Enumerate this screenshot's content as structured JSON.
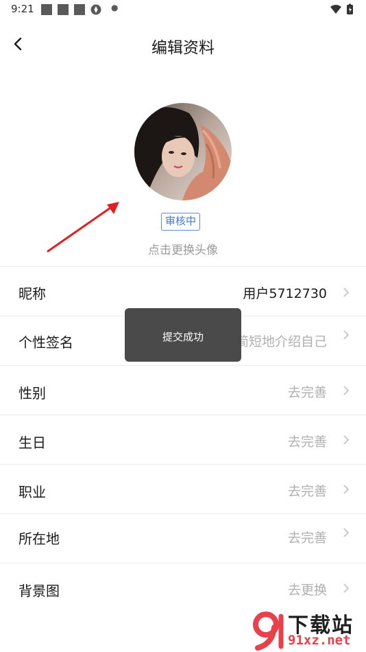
{
  "status_bar": {
    "time": "9:21"
  },
  "header": {
    "title": "编辑资料"
  },
  "avatar": {
    "badge": "审核中",
    "hint": "点击更换头像"
  },
  "rows": [
    {
      "label": "昵称",
      "value": "用户5712730"
    },
    {
      "label": "个性签名",
      "value": "简短地介绍自己"
    },
    {
      "label": "性别",
      "value": "去完善"
    },
    {
      "label": "生日",
      "value": "去完善"
    },
    {
      "label": "职业",
      "value": "去完善"
    },
    {
      "label": "所在地",
      "value": "去完善"
    },
    {
      "label": "背景图",
      "value": "去更换"
    }
  ],
  "toast": {
    "text": "提交成功"
  },
  "watermark": {
    "title": "下载站",
    "url": "91xz.net"
  },
  "colors": {
    "badge_blue": "#3f78e0",
    "annotation_red": "#e02020",
    "placeholder_gray": "#b0b0b0"
  }
}
